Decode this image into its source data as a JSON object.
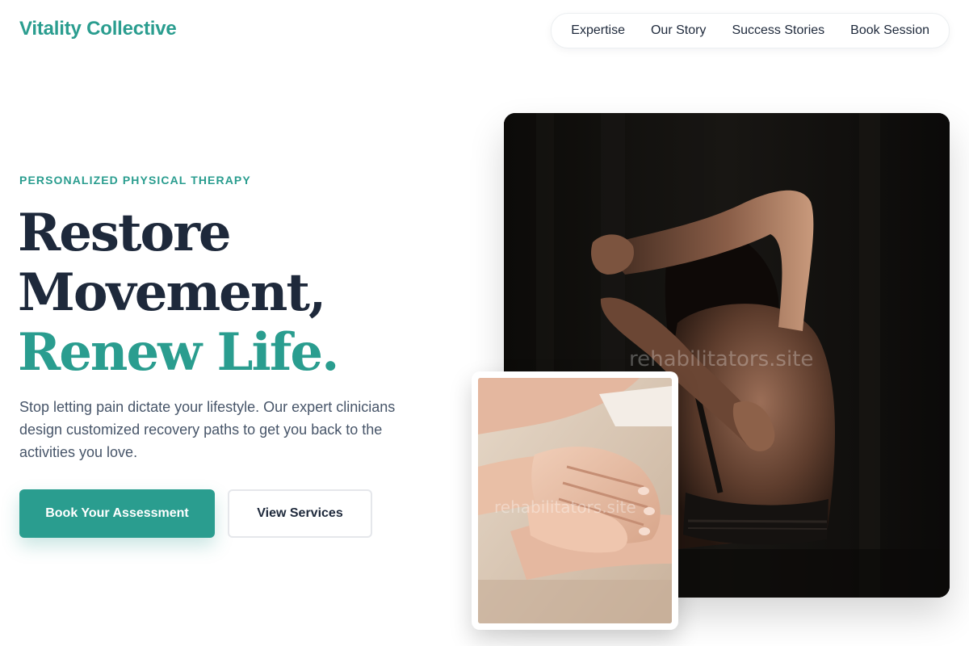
{
  "brand": {
    "name": "Vitality Collective",
    "color": "#2a9d8f"
  },
  "nav": {
    "items": [
      "Expertise",
      "Our Story",
      "Success Stories",
      "Book Session"
    ]
  },
  "hero": {
    "eyebrow": "PERSONALIZED PHYSICAL THERAPY",
    "headline_line1": "Restore",
    "headline_line2": "Movement,",
    "headline_accent": "Renew Life.",
    "description": "Stop letting pain dictate your lifestyle. Our expert clinicians design customized recovery paths to get you back to the activities you love.",
    "primary_cta": "Book Your Assessment",
    "secondary_cta": "View Services"
  },
  "images": {
    "main_watermark": "rehabilitators.site",
    "inset_watermark": "rehabilitators.site"
  }
}
